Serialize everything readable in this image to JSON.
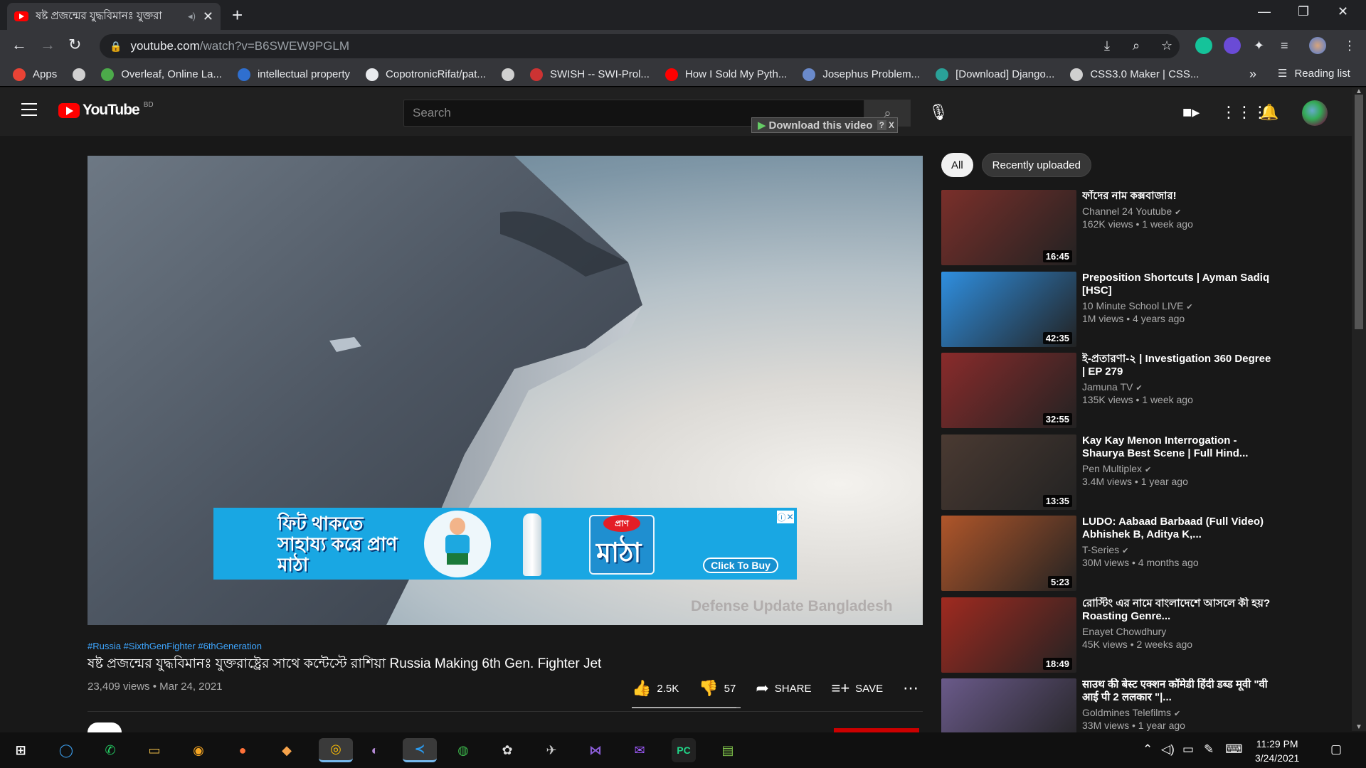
{
  "browser": {
    "tab_title": "ষষ্ট প্রজন্মের যুদ্ধবিমানঃ যুক্তরা",
    "url_host": "youtube.com",
    "url_path": "/watch?v=B6SWEW9PGLM",
    "bookmarks": [
      {
        "label": "Apps",
        "color": "#e94335"
      },
      {
        "label": "",
        "color": "#d0d0d0"
      },
      {
        "label": "Overleaf, Online La...",
        "color": "#4caa4a"
      },
      {
        "label": "intellectual property",
        "color": "#2f6fcf"
      },
      {
        "label": "CopotronicRifat/pat...",
        "color": "#e8eaed"
      },
      {
        "label": "",
        "color": "#d0d0d0"
      },
      {
        "label": "SWISH -- SWI-Prol...",
        "color": "#c33"
      },
      {
        "label": "How I Sold My Pyth...",
        "color": "#ff0000"
      },
      {
        "label": "Josephus Problem...",
        "color": "#6a8acb"
      },
      {
        "label": "[Download] Django...",
        "color": "#2aa198"
      },
      {
        "label": "CSS3.0 Maker | CSS...",
        "color": "#d0d0d0"
      }
    ],
    "reading_list": "Reading list",
    "more": "»"
  },
  "youtube": {
    "logo_text": "YouTube",
    "country_code": "BD",
    "search_placeholder": "Search",
    "download_bar": "Download this video",
    "download_help": "?",
    "download_close": "X"
  },
  "player": {
    "watermark": "Defense Update Bangladesh",
    "ad": {
      "headline": "ফিট থাকতে সাহায্য করে প্রাণ মাঠা",
      "brand": "প্রাণ",
      "product": "মাঠা",
      "cta": "Click To Buy"
    }
  },
  "video": {
    "tags": "#Russia #SixthGenFighter #6thGeneration",
    "title": "ষষ্ট প্রজন্মের যুদ্ধবিমানঃ যুক্তরাষ্ট্রের সাথে কন্টেস্টে রাশিয়া Russia Making 6th Gen. Fighter Jet",
    "views_date": "23,409 views • Mar 24, 2021",
    "likes": "2.5K",
    "dislikes": "57",
    "share": "SHARE",
    "save": "SAVE",
    "like_ratio": 0.96
  },
  "chips": [
    "All",
    "Recently uploaded"
  ],
  "recommendations": [
    {
      "title": "ফাঁদের নাম কক্সবাজার!",
      "channel": "Channel 24 Youtube",
      "verified": true,
      "meta": "162K views • 1 week ago",
      "duration": "16:45",
      "bg": "#7a2f2a"
    },
    {
      "title": "Preposition Shortcuts | Ayman Sadiq [HSC]",
      "channel": "10 Minute School LIVE",
      "verified": true,
      "meta": "1M views • 4 years ago",
      "duration": "42:35",
      "bg": "#2f8fe0"
    },
    {
      "title": "ই-প্রতারণা-২ | Investigation 360 Degree | EP 279",
      "channel": "Jamuna TV",
      "verified": true,
      "meta": "135K views • 1 week ago",
      "duration": "32:55",
      "bg": "#8a2b2b"
    },
    {
      "title": "Kay Kay Menon Interrogation - Shaurya Best Scene | Full Hind...",
      "channel": "Pen Multiplex",
      "verified": true,
      "meta": "3.4M views • 1 year ago",
      "duration": "13:35",
      "bg": "#4a3a32"
    },
    {
      "title": "LUDO: Aabaad Barbaad (Full Video) Abhishek B, Aditya K,...",
      "channel": "T-Series",
      "verified": true,
      "meta": "30M views • 4 months ago",
      "duration": "5:23",
      "bg": "#b0562a"
    },
    {
      "title": "রোস্টিং এর নামে বাংলাদেশে আসলে কী হয়? Roasting Genre...",
      "channel": "Enayet Chowdhury",
      "verified": false,
      "meta": "45K views • 2 weeks ago",
      "duration": "18:49",
      "bg": "#a02a20"
    },
    {
      "title": "साउथ की बेस्ट एक्शन कॉमेडी हिंदी डब्ड मूवी \"वी आई पी 2 ललकार \"|...",
      "channel": "Goldmines Telefilms",
      "verified": true,
      "meta": "33M views • 1 year ago",
      "duration": "",
      "bg": "#6a5a8a"
    }
  ],
  "taskbar": {
    "time": "11:29 PM",
    "date": "3/24/2021"
  }
}
